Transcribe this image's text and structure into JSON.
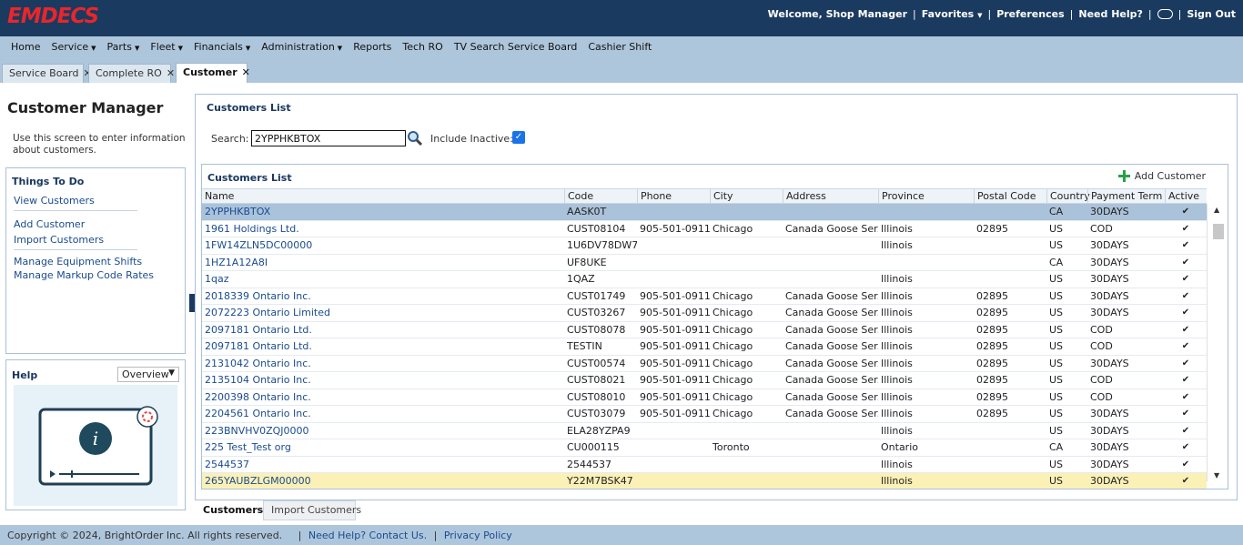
{
  "app": {
    "logo_text": "EMDECS",
    "brand_color": "#e8262b",
    "header_color": "#1b3a5f"
  },
  "topbar": {
    "welcome": "Welcome, Shop Manager",
    "favorites": "Favorites",
    "preferences": "Preferences",
    "need_help": "Need Help?",
    "sign_out": "Sign Out",
    "sep": "|"
  },
  "menu": {
    "items": [
      {
        "label": "Home",
        "caret": false
      },
      {
        "label": "Service",
        "caret": true
      },
      {
        "label": "Parts",
        "caret": true
      },
      {
        "label": "Fleet",
        "caret": true
      },
      {
        "label": "Financials",
        "caret": true
      },
      {
        "label": "Administration",
        "caret": true
      },
      {
        "label": "Reports",
        "caret": false
      },
      {
        "label": "Tech RO",
        "caret": false
      },
      {
        "label": "TV Search Service Board",
        "caret": false
      },
      {
        "label": "Cashier Shift",
        "caret": false
      }
    ]
  },
  "tabs": [
    {
      "label": "Service Board",
      "active": false
    },
    {
      "label": "Complete RO",
      "active": false
    },
    {
      "label": "Customer",
      "active": true
    }
  ],
  "left": {
    "title": "Customer Manager",
    "description": "Use this screen to enter information about customers.",
    "things_title": "Things To Do",
    "links": [
      "View Customers",
      "Add Customer",
      "Import Customers",
      "Manage Equipment Shifts",
      "Manage Markup Code Rates"
    ],
    "help_title": "Help",
    "help_select": "Overview"
  },
  "customers": {
    "section_title": "Customers List",
    "search_label": "Search:",
    "search_value": "2YPPHKBTOX",
    "include_inactive_label": "Include Inactive:",
    "include_inactive": true,
    "grid_title": "Customers List",
    "add_customer": "Add Customer",
    "columns": [
      "Name",
      "Code",
      "Phone",
      "City",
      "Address",
      "Province",
      "Postal Code",
      "Country",
      "Payment Term",
      "Active"
    ],
    "rows": [
      {
        "name": "2YPPHKBTOX",
        "code": "AASK0T",
        "phone": "",
        "city": "",
        "address": "",
        "province": "",
        "postal": "",
        "country": "CA",
        "term": "30DAYS",
        "active": "✔",
        "state": "selected"
      },
      {
        "name": "1961 Holdings Ltd.",
        "code": "CUST08104",
        "phone": "905-501-0911",
        "city": "Chicago",
        "address": "Canada Goose Ser...",
        "province": "Illinois",
        "postal": "02895",
        "country": "US",
        "term": "COD",
        "active": "✔",
        "state": ""
      },
      {
        "name": "1FW14ZLN5DC00000",
        "code": "1U6DV78DW7",
        "phone": "",
        "city": "",
        "address": "",
        "province": "Illinois",
        "postal": "",
        "country": "US",
        "term": "30DAYS",
        "active": "✔",
        "state": ""
      },
      {
        "name": "1HZ1A12A8I",
        "code": "UF8UKE",
        "phone": "",
        "city": "",
        "address": "",
        "province": "",
        "postal": "",
        "country": "CA",
        "term": "30DAYS",
        "active": "✔",
        "state": ""
      },
      {
        "name": "1qaz",
        "code": "1QAZ",
        "phone": "",
        "city": "",
        "address": "",
        "province": "Illinois",
        "postal": "",
        "country": "US",
        "term": "30DAYS",
        "active": "✔",
        "state": ""
      },
      {
        "name": "2018339 Ontario Inc.",
        "code": "CUST01749",
        "phone": "905-501-0911",
        "city": "Chicago",
        "address": "Canada Goose Ser...",
        "province": "Illinois",
        "postal": "02895",
        "country": "US",
        "term": "30DAYS",
        "active": "✔",
        "state": ""
      },
      {
        "name": "2072223 Ontario Limited",
        "code": "CUST03267",
        "phone": "905-501-0911",
        "city": "Chicago",
        "address": "Canada Goose Ser...",
        "province": "Illinois",
        "postal": "02895",
        "country": "US",
        "term": "30DAYS",
        "active": "✔",
        "state": ""
      },
      {
        "name": "2097181 Ontario Ltd.",
        "code": "CUST08078",
        "phone": "905-501-0911",
        "city": "Chicago",
        "address": "Canada Goose Ser...",
        "province": "Illinois",
        "postal": "02895",
        "country": "US",
        "term": "COD",
        "active": "✔",
        "state": ""
      },
      {
        "name": "2097181 Ontario Ltd.",
        "code": "TESTIN",
        "phone": "905-501-0911",
        "city": "Chicago",
        "address": "Canada Goose Ser...",
        "province": "Illinois",
        "postal": "02895",
        "country": "US",
        "term": "COD",
        "active": "✔",
        "state": ""
      },
      {
        "name": "2131042 Ontario Inc.",
        "code": "CUST00574",
        "phone": "905-501-0911",
        "city": "Chicago",
        "address": "Canada Goose Ser...",
        "province": "Illinois",
        "postal": "02895",
        "country": "US",
        "term": "30DAYS",
        "active": "✔",
        "state": ""
      },
      {
        "name": "2135104 Ontario Inc.",
        "code": "CUST08021",
        "phone": "905-501-0911",
        "city": "Chicago",
        "address": "Canada Goose Ser...",
        "province": "Illinois",
        "postal": "02895",
        "country": "US",
        "term": "COD",
        "active": "✔",
        "state": ""
      },
      {
        "name": "2200398 Ontario Inc.",
        "code": "CUST08010",
        "phone": "905-501-0911",
        "city": "Chicago",
        "address": "Canada Goose Ser...",
        "province": "Illinois",
        "postal": "02895",
        "country": "US",
        "term": "COD",
        "active": "✔",
        "state": ""
      },
      {
        "name": "2204561 Ontario Inc.",
        "code": "CUST03079",
        "phone": "905-501-0911",
        "city": "Chicago",
        "address": "Canada Goose Ser...",
        "province": "Illinois",
        "postal": "02895",
        "country": "US",
        "term": "30DAYS",
        "active": "✔",
        "state": ""
      },
      {
        "name": "223BNVHV0ZQJ0000",
        "code": "ELA28YZPA9",
        "phone": "",
        "city": "",
        "address": "",
        "province": "Illinois",
        "postal": "",
        "country": "US",
        "term": "30DAYS",
        "active": "✔",
        "state": ""
      },
      {
        "name": "225 Test_Test org",
        "code": "CU000115",
        "phone": "",
        "city": "Toronto",
        "address": "",
        "province": "Ontario",
        "postal": "",
        "country": "CA",
        "term": "30DAYS",
        "active": "✔",
        "state": ""
      },
      {
        "name": "2544537",
        "code": "2544537",
        "phone": "",
        "city": "",
        "address": "",
        "province": "Illinois",
        "postal": "",
        "country": "US",
        "term": "30DAYS",
        "active": "✔",
        "state": ""
      },
      {
        "name": "265YAUBZLGM00000",
        "code": "Y22M7BSK47",
        "phone": "",
        "city": "",
        "address": "",
        "province": "Illinois",
        "postal": "",
        "country": "US",
        "term": "30DAYS",
        "active": "✔",
        "state": "highlight"
      }
    ]
  },
  "bottom_tabs": [
    {
      "label": "Customers",
      "active": true
    },
    {
      "label": "Import Customers",
      "active": false
    }
  ],
  "footer": {
    "copyright": "Copyright © 2024, BrightOrder Inc. All rights reserved.",
    "help_link": "Need Help? Contact Us.",
    "privacy_link": "Privacy Policy"
  }
}
